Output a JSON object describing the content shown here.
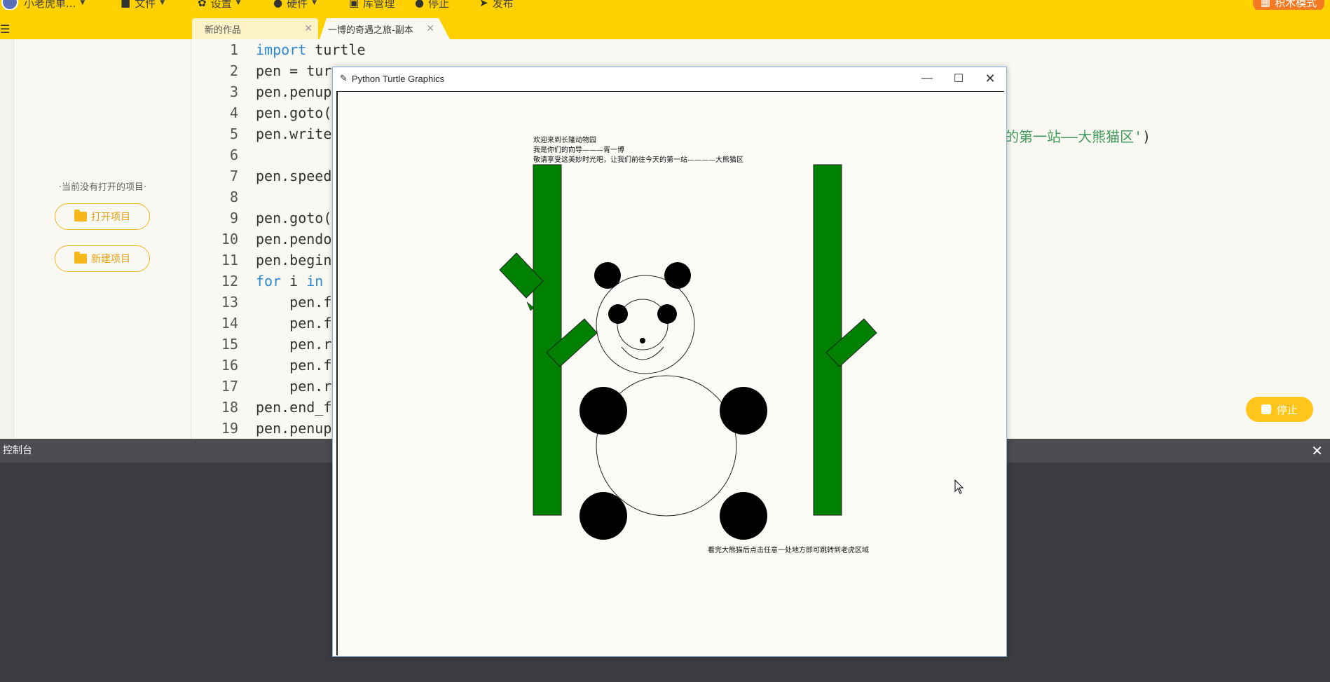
{
  "menu": {
    "user": "小老虎单...",
    "file": "文件",
    "settings": "设置",
    "hardware": "硬件",
    "library": "库管理",
    "stop": "停止",
    "publish": "发布",
    "mode": "积木模式"
  },
  "tabs": [
    {
      "label": "新的作品"
    },
    {
      "label": "一博的奇遇之旅-副本"
    }
  ],
  "sidebar": {
    "no_project": "·当前没有打开的项目·",
    "open_project": "打开项目",
    "new_project": "新建项目"
  },
  "editor": {
    "lines": [
      {
        "n": "1",
        "kw": "import",
        "rest": " turtle"
      },
      {
        "n": "2",
        "kw": "",
        "rest": "pen = tur"
      },
      {
        "n": "3",
        "kw": "",
        "rest": "pen.penup"
      },
      {
        "n": "4",
        "kw": "",
        "rest": "pen.goto("
      },
      {
        "n": "5",
        "kw": "",
        "rest": "pen.write"
      },
      {
        "n": "6",
        "kw": "",
        "rest": ""
      },
      {
        "n": "7",
        "kw": "",
        "rest": "pen.speed"
      },
      {
        "n": "8",
        "kw": "",
        "rest": ""
      },
      {
        "n": "9",
        "kw": "",
        "rest": "pen.goto("
      },
      {
        "n": "10",
        "kw": "",
        "rest": "pen.pendo"
      },
      {
        "n": "11",
        "kw": "",
        "rest": "pen.begin"
      },
      {
        "n": "12",
        "kw": "for",
        "rest": " i ",
        "kw2": "in"
      },
      {
        "n": "13",
        "kw": "",
        "rest": "    pen.f"
      },
      {
        "n": "14",
        "kw": "",
        "rest": "    pen.f"
      },
      {
        "n": "15",
        "kw": "",
        "rest": "    pen.r"
      },
      {
        "n": "16",
        "kw": "",
        "rest": "    pen.f"
      },
      {
        "n": "17",
        "kw": "",
        "rest": "    pen.r"
      },
      {
        "n": "18",
        "kw": "",
        "rest": "pen.end_f"
      },
      {
        "n": "19",
        "kw": "",
        "rest": "pen.penup"
      }
    ],
    "line5_tail": "的第一站——大熊猫区'",
    "line5_close": ")"
  },
  "stop_button": "停止",
  "console": {
    "title": "控制台"
  },
  "turtle_window": {
    "title": "Python Turtle Graphics",
    "canvas_text": {
      "line1": "欢迎来到长隆动物园",
      "line2": "我是你们的向导———胥一博",
      "line3": "敬请享受这美妙时光吧，让我们前往今天的第一站————大熊猫区",
      "footer": "看完大熊猫后点击任意一处地方即可跳转到老虎区域"
    }
  },
  "colors": {
    "topbar": "#ffd100",
    "bamboo": "#008000",
    "accent_orange": "#f47a24",
    "keyword": "#2e8ad6",
    "string": "#3e9b5a"
  }
}
